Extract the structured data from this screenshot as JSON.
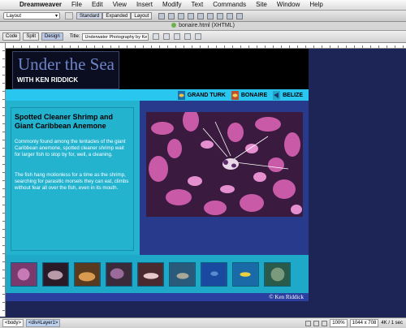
{
  "menubar": {
    "items": [
      "Dreamweaver",
      "File",
      "Edit",
      "View",
      "Insert",
      "Modify",
      "Text",
      "Commands",
      "Site",
      "Window",
      "Help"
    ]
  },
  "insertbar": {
    "category": "Layout",
    "modes": [
      "Standard",
      "Expanded",
      "Layout"
    ]
  },
  "document": {
    "title": "bonaire.html (XHTML)"
  },
  "doc_toolbar": {
    "views": [
      "Code",
      "Split",
      "Design"
    ],
    "title_label": "Title:",
    "title_value": "Underwater Photography by Ke"
  },
  "page": {
    "logo_title": "Under the Sea",
    "logo_subtitle": "WITH KEN RIDDICK",
    "nav": [
      "GRAND TURK",
      "BONAIRE",
      "BELIZE"
    ],
    "article_title": "Spotted Cleaner Shrimp and Giant Caribbean Anemone",
    "article_p1": "Commonly found among the tentacles of the giant Caribbean anemone, spotted cleaner shrimp wait for larger fish to stop by for, well, a cleaning.",
    "article_p2": "The fish hang motionless for a time as the shrimp, searching for parasitic morsels they can eat, climbs without fear all over the fish, even in its mouth.",
    "footer": "© Ken Riddick"
  },
  "statusbar": {
    "tags": [
      "<body>",
      "<div#Layer1>"
    ],
    "zoom": "100%",
    "size": "1044 x 708",
    "download": "4K / 1 sec"
  },
  "colors": {
    "nav_bar": "#29c6f0",
    "content_left": "#23b3cf",
    "content_right": "#283a8c",
    "workspace": "#1d2456"
  }
}
